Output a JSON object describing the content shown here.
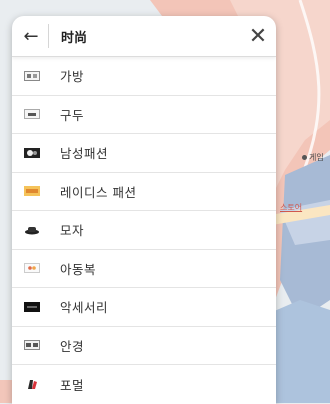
{
  "header": {
    "title": "时尚",
    "back_icon": "arrow-left-icon",
    "close_icon": "close-icon"
  },
  "categories": [
    {
      "label": "가방",
      "icon": "bag-thumb-icon"
    },
    {
      "label": "구두",
      "icon": "shoes-thumb-icon"
    },
    {
      "label": "남성패션",
      "icon": "mens-fashion-thumb-icon"
    },
    {
      "label": "레이디스 패션",
      "icon": "ladies-fashion-thumb-icon"
    },
    {
      "label": "모자",
      "icon": "hat-thumb-icon"
    },
    {
      "label": "아동복",
      "icon": "kids-clothing-thumb-icon"
    },
    {
      "label": "악세서리",
      "icon": "accessory-thumb-icon"
    },
    {
      "label": "안경",
      "icon": "glasses-thumb-icon"
    },
    {
      "label": "포멀",
      "icon": "formal-thumb-icon"
    }
  ],
  "map": {
    "labels": {
      "game": "게임",
      "store": "스토어"
    },
    "colors": {
      "salmon": "#f0b9ab",
      "blue": "#a9c0dd",
      "gray": "#e6eaed"
    }
  }
}
